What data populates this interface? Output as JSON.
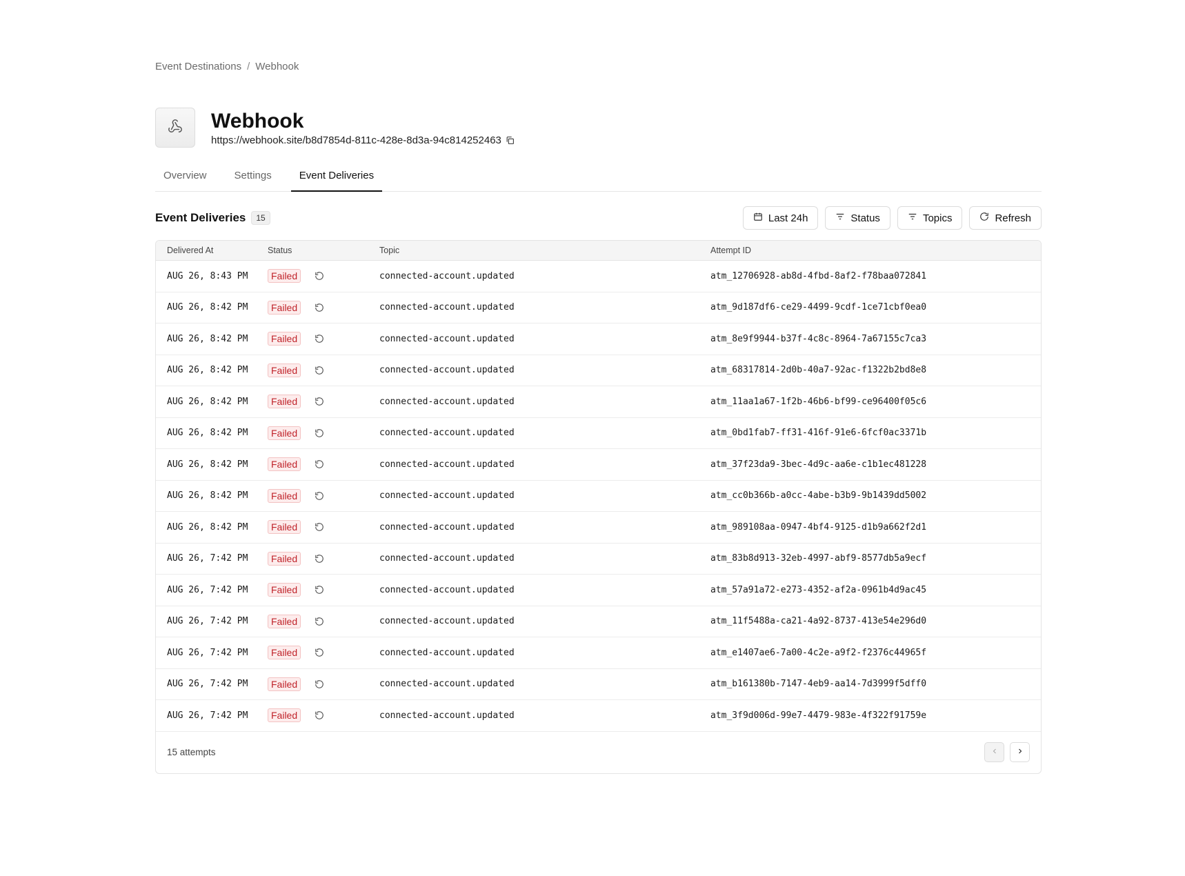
{
  "breadcrumb": {
    "parent": "Event Destinations",
    "separator": "/",
    "current": "Webhook"
  },
  "header": {
    "icon": "webhook-icon",
    "title": "Webhook",
    "url": "https://webhook.site/b8d7854d-811c-428e-8d3a-94c814252463"
  },
  "tabs": [
    {
      "label": "Overview",
      "active": false
    },
    {
      "label": "Settings",
      "active": false
    },
    {
      "label": "Event Deliveries",
      "active": true
    }
  ],
  "section": {
    "title": "Event Deliveries",
    "count": "15",
    "buttons": {
      "range": "Last 24h",
      "status": "Status",
      "topics": "Topics",
      "refresh": "Refresh"
    }
  },
  "table": {
    "headers": {
      "delivered_at": "Delivered At",
      "status": "Status",
      "topic": "Topic",
      "attempt_id": "Attempt ID"
    },
    "rows": [
      {
        "delivered_at": "AUG 26, 8:43 PM",
        "status": "Failed",
        "topic": "connected-account.updated",
        "attempt_id": "atm_12706928-ab8d-4fbd-8af2-f78baa072841"
      },
      {
        "delivered_at": "AUG 26, 8:42 PM",
        "status": "Failed",
        "topic": "connected-account.updated",
        "attempt_id": "atm_9d187df6-ce29-4499-9cdf-1ce71cbf0ea0"
      },
      {
        "delivered_at": "AUG 26, 8:42 PM",
        "status": "Failed",
        "topic": "connected-account.updated",
        "attempt_id": "atm_8e9f9944-b37f-4c8c-8964-7a67155c7ca3"
      },
      {
        "delivered_at": "AUG 26, 8:42 PM",
        "status": "Failed",
        "topic": "connected-account.updated",
        "attempt_id": "atm_68317814-2d0b-40a7-92ac-f1322b2bd8e8"
      },
      {
        "delivered_at": "AUG 26, 8:42 PM",
        "status": "Failed",
        "topic": "connected-account.updated",
        "attempt_id": "atm_11aa1a67-1f2b-46b6-bf99-ce96400f05c6"
      },
      {
        "delivered_at": "AUG 26, 8:42 PM",
        "status": "Failed",
        "topic": "connected-account.updated",
        "attempt_id": "atm_0bd1fab7-ff31-416f-91e6-6fcf0ac3371b"
      },
      {
        "delivered_at": "AUG 26, 8:42 PM",
        "status": "Failed",
        "topic": "connected-account.updated",
        "attempt_id": "atm_37f23da9-3bec-4d9c-aa6e-c1b1ec481228"
      },
      {
        "delivered_at": "AUG 26, 8:42 PM",
        "status": "Failed",
        "topic": "connected-account.updated",
        "attempt_id": "atm_cc0b366b-a0cc-4abe-b3b9-9b1439dd5002"
      },
      {
        "delivered_at": "AUG 26, 8:42 PM",
        "status": "Failed",
        "topic": "connected-account.updated",
        "attempt_id": "atm_989108aa-0947-4bf4-9125-d1b9a662f2d1"
      },
      {
        "delivered_at": "AUG 26, 7:42 PM",
        "status": "Failed",
        "topic": "connected-account.updated",
        "attempt_id": "atm_83b8d913-32eb-4997-abf9-8577db5a9ecf"
      },
      {
        "delivered_at": "AUG 26, 7:42 PM",
        "status": "Failed",
        "topic": "connected-account.updated",
        "attempt_id": "atm_57a91a72-e273-4352-af2a-0961b4d9ac45"
      },
      {
        "delivered_at": "AUG 26, 7:42 PM",
        "status": "Failed",
        "topic": "connected-account.updated",
        "attempt_id": "atm_11f5488a-ca21-4a92-8737-413e54e296d0"
      },
      {
        "delivered_at": "AUG 26, 7:42 PM",
        "status": "Failed",
        "topic": "connected-account.updated",
        "attempt_id": "atm_e1407ae6-7a00-4c2e-a9f2-f2376c44965f"
      },
      {
        "delivered_at": "AUG 26, 7:42 PM",
        "status": "Failed",
        "topic": "connected-account.updated",
        "attempt_id": "atm_b161380b-7147-4eb9-aa14-7d3999f5dff0"
      },
      {
        "delivered_at": "AUG 26, 7:42 PM",
        "status": "Failed",
        "topic": "connected-account.updated",
        "attempt_id": "atm_3f9d006d-99e7-4479-983e-4f322f91759e"
      }
    ],
    "footer": "15 attempts"
  },
  "colors": {
    "failed_text": "#c0242b",
    "failed_bg": "#fdecec",
    "border": "#e4e4e4"
  }
}
